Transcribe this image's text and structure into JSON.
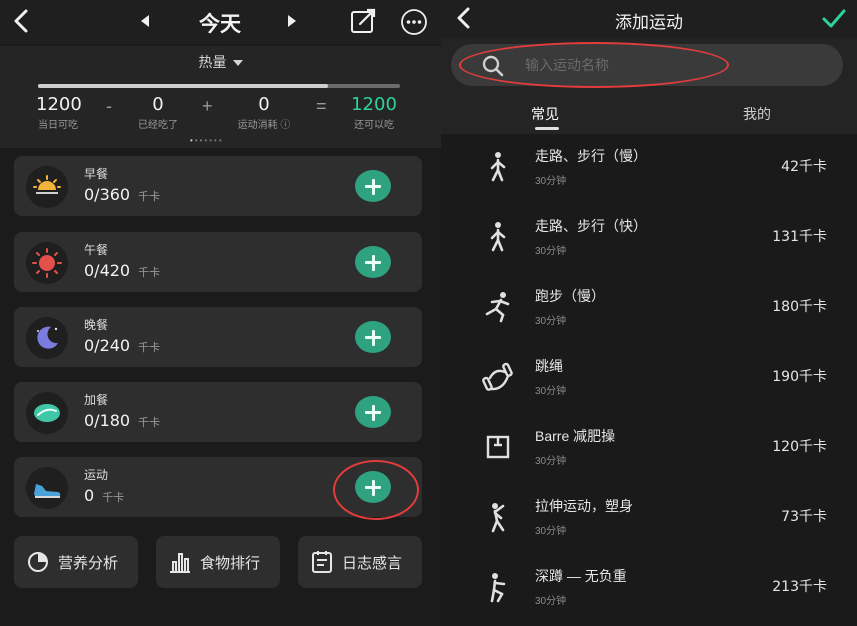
{
  "left": {
    "header": {
      "title": "今天"
    },
    "summary": {
      "metric_label": "热量",
      "progress_fraction": 0.8,
      "budget": {
        "value": "1200",
        "caption": "当日可吃"
      },
      "op_minus": "-",
      "eaten": {
        "value": "0",
        "caption": "已经吃了"
      },
      "op_plus": "+",
      "burned": {
        "value": "0",
        "caption": "运动消耗 ⓘ"
      },
      "op_equal": "=",
      "remaining": {
        "value": "1200",
        "caption": "还可以吃"
      }
    },
    "meals": [
      {
        "name": "早餐",
        "value": "0/360",
        "unit": "千卡",
        "icon": "sunrise-icon"
      },
      {
        "name": "午餐",
        "value": "0/420",
        "unit": "千卡",
        "icon": "sun-icon"
      },
      {
        "name": "晚餐",
        "value": "0/240",
        "unit": "千卡",
        "icon": "moon-icon"
      },
      {
        "name": "加餐",
        "value": "0/180",
        "unit": "千卡",
        "icon": "snack-icon"
      },
      {
        "name": "运动",
        "value": "0",
        "unit": "千卡",
        "icon": "sneaker-icon"
      }
    ],
    "bottom_buttons": [
      {
        "label": "营养分析",
        "icon": "pie-chart-icon"
      },
      {
        "label": "食物排行",
        "icon": "bar-chart-icon"
      },
      {
        "label": "日志感言",
        "icon": "journal-icon"
      }
    ]
  },
  "right": {
    "header": {
      "title": "添加运动"
    },
    "search": {
      "placeholder": "输入运动名称"
    },
    "tabs": [
      {
        "label": "常见"
      },
      {
        "label": "我的"
      }
    ],
    "exercises": [
      {
        "name": "走路、步行（慢）",
        "duration": "30分钟",
        "calories": "42千卡",
        "icon": "walking-icon"
      },
      {
        "name": "走路、步行（快）",
        "duration": "30分钟",
        "calories": "131千卡",
        "icon": "walking-icon"
      },
      {
        "name": "跑步（慢）",
        "duration": "30分钟",
        "calories": "180千卡",
        "icon": "running-icon"
      },
      {
        "name": "跳绳",
        "duration": "30分钟",
        "calories": "190千卡",
        "icon": "jump-rope-icon"
      },
      {
        "name": "Barre 减肥操",
        "duration": "30分钟",
        "calories": "120千卡",
        "icon": "barre-icon"
      },
      {
        "name": "拉伸运动，塑身",
        "duration": "30分钟",
        "calories": "73千卡",
        "icon": "stretching-icon"
      },
      {
        "name": "深蹲 — 无负重",
        "duration": "30分钟",
        "calories": "213千卡",
        "icon": "squat-icon"
      }
    ]
  }
}
